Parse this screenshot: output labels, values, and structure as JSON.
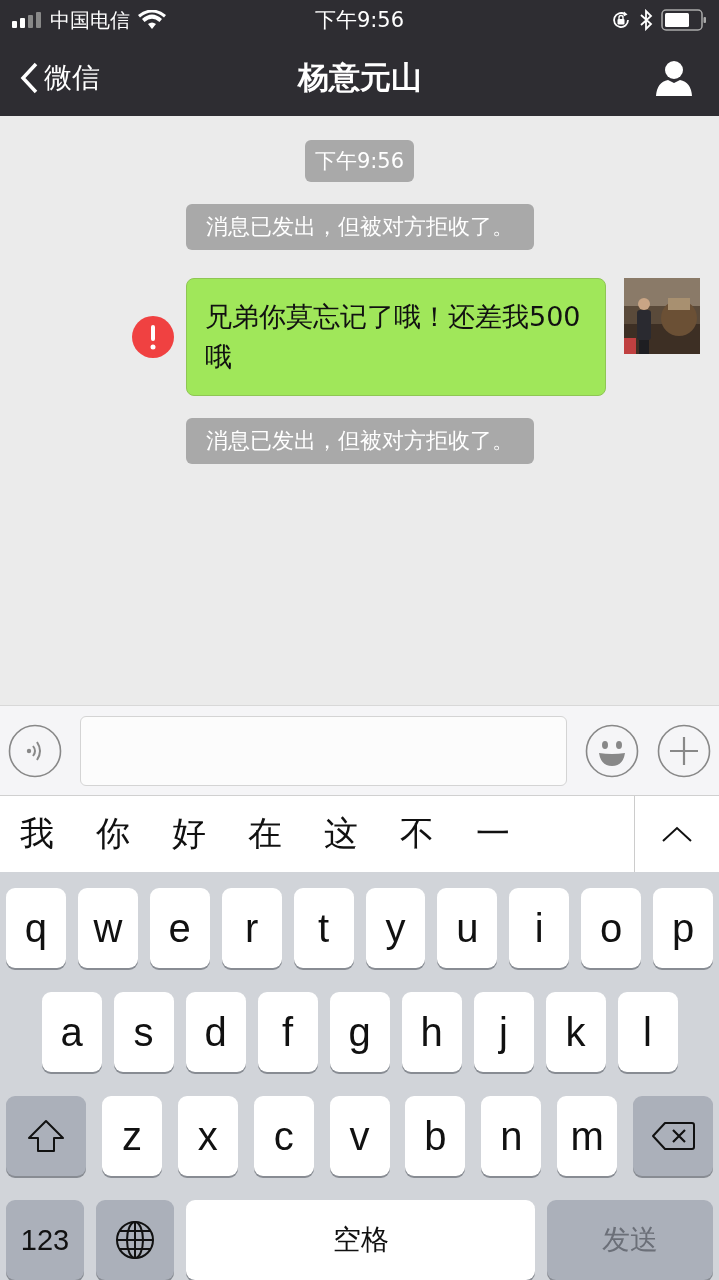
{
  "status_bar": {
    "carrier": "中国电信",
    "time": "下午9:56"
  },
  "nav": {
    "back_label": "微信",
    "title": "杨意元山"
  },
  "messages": [
    {
      "kind": "time",
      "text": "下午9:56"
    },
    {
      "kind": "system",
      "text": "消息已发出，但被对方拒收了。"
    },
    {
      "kind": "outgoing",
      "text": "兄弟你莫忘记了哦！还差我500哦",
      "failed": true
    },
    {
      "kind": "system",
      "text": "消息已发出，但被对方拒收了。"
    }
  ],
  "candidates": [
    "我",
    "你",
    "好",
    "在",
    "这",
    "不",
    "一"
  ],
  "keyboard": {
    "rows": [
      {
        "keys": [
          {
            "kind": "letter",
            "label": "q"
          },
          {
            "kind": "letter",
            "label": "w"
          },
          {
            "kind": "letter",
            "label": "e"
          },
          {
            "kind": "letter",
            "label": "r"
          },
          {
            "kind": "letter",
            "label": "t"
          },
          {
            "kind": "letter",
            "label": "y"
          },
          {
            "kind": "letter",
            "label": "u"
          },
          {
            "kind": "letter",
            "label": "i"
          },
          {
            "kind": "letter",
            "label": "o"
          },
          {
            "kind": "letter",
            "label": "p"
          }
        ]
      },
      {
        "keys": [
          {
            "kind": "letter",
            "label": "a"
          },
          {
            "kind": "letter",
            "label": "s"
          },
          {
            "kind": "letter",
            "label": "d"
          },
          {
            "kind": "letter",
            "label": "f"
          },
          {
            "kind": "letter",
            "label": "g"
          },
          {
            "kind": "letter",
            "label": "h"
          },
          {
            "kind": "letter",
            "label": "j"
          },
          {
            "kind": "letter",
            "label": "k"
          },
          {
            "kind": "letter",
            "label": "l"
          }
        ]
      },
      {
        "keys": [
          {
            "kind": "shift"
          },
          {
            "kind": "letter",
            "label": "z"
          },
          {
            "kind": "letter",
            "label": "x"
          },
          {
            "kind": "letter",
            "label": "c"
          },
          {
            "kind": "letter",
            "label": "v"
          },
          {
            "kind": "letter",
            "label": "b"
          },
          {
            "kind": "letter",
            "label": "n"
          },
          {
            "kind": "letter",
            "label": "m"
          },
          {
            "kind": "delete"
          }
        ]
      },
      {
        "keys": [
          {
            "kind": "numbers",
            "label": "123"
          },
          {
            "kind": "globe"
          },
          {
            "kind": "space",
            "label": "空格"
          },
          {
            "kind": "send",
            "label": "发送",
            "disabled": true
          }
        ]
      }
    ]
  }
}
